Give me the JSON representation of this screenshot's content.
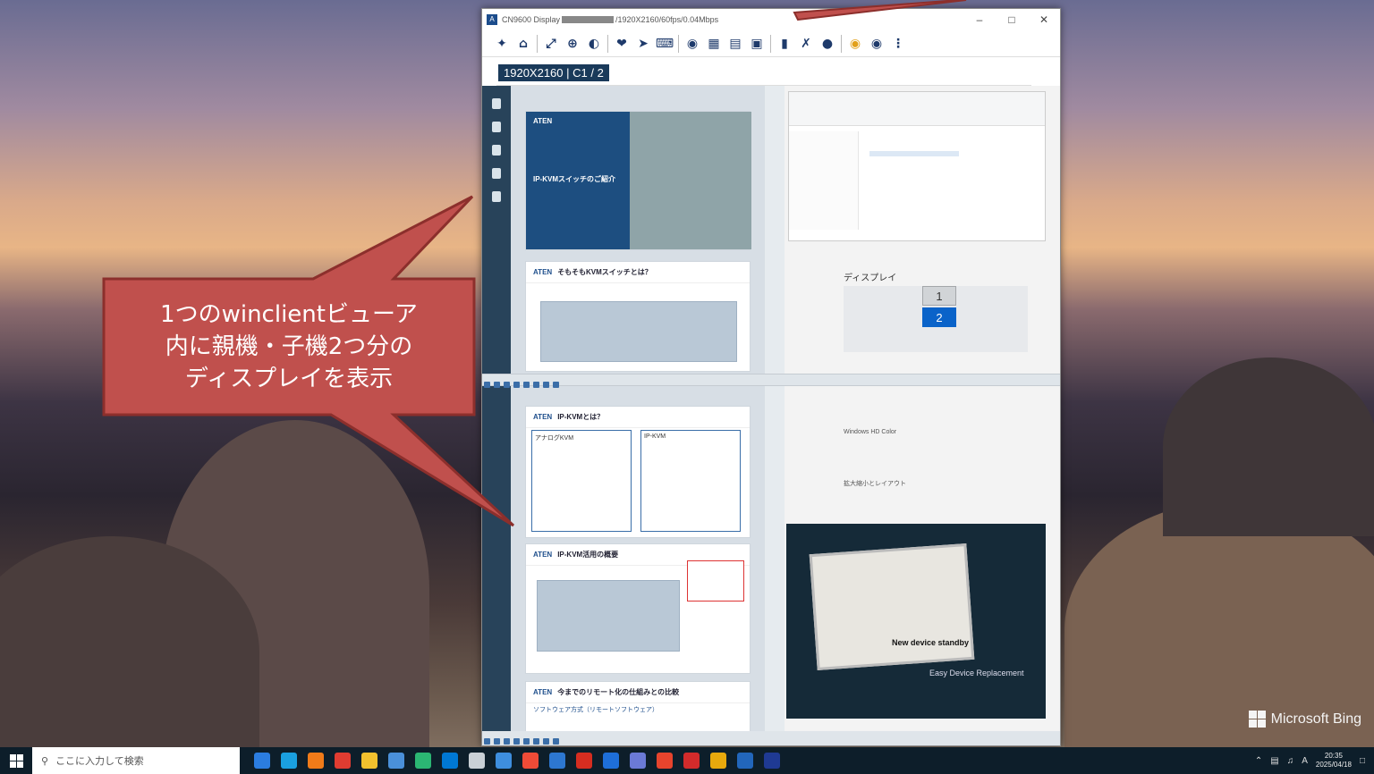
{
  "window": {
    "title_prefix": "CN9600 Display",
    "title_suffix": "/1920X2160/60fps/0.04Mbps",
    "resolution_label": "1920X2160 | C1 / 2",
    "toolbar_icons": [
      "pin-icon",
      "home-icon",
      "fullscreen-icon",
      "zoom-icon",
      "contrast-icon",
      "macro-icon",
      "pointer-icon",
      "keyboard-icon",
      "camera-icon",
      "video-icon",
      "panel-icon",
      "list-icon",
      "usb-icon",
      "tools-icon",
      "chat-icon",
      "lock-icon",
      "unlock-icon",
      "more-icon"
    ]
  },
  "remote": {
    "slides": [
      {
        "brand": "ATEN",
        "title": "IP-KVMスイッチのご紹介"
      },
      {
        "brand": "ATEN",
        "title": "そもそもKVMスイッチとは？"
      },
      {
        "brand": "ATEN",
        "title": "IP-KVMとは？"
      },
      {
        "brand": "ATEN",
        "title": "IP-KVM活用の概要"
      },
      {
        "brand": "ATEN",
        "title": "今までのリモート化の仕組みとの比較"
      }
    ],
    "slide2_sub": "ソフトウェア方式（リモートソフトウェア）",
    "kvm_labels": {
      "analog": "アナログKVM",
      "ip": "IP-KVM"
    },
    "display_title": "ディスプレイ",
    "monitors": [
      "1",
      "2"
    ],
    "settings": {
      "hdr": "Windows HD Color",
      "scale": "拡大縮小とレイアウト"
    },
    "video_caption": "Easy Device Replacement",
    "video_overlay": "New device standby"
  },
  "callout": {
    "lines": [
      "1つのwinclientビューア",
      "内に親機・子機2つ分の",
      "ディスプレイを表示"
    ],
    "color": "#c0504d"
  },
  "desktop": {
    "watermark": "Microsoft Bing"
  },
  "taskbar": {
    "search_placeholder": "ここに入力して検索",
    "apps": [
      "#2b7de0",
      "#1aa0e0",
      "#f07b19",
      "#e03c31",
      "#f2c12e",
      "#4a90d9",
      "#2bb673",
      "#0078d4",
      "#c9d0d6",
      "#3e8ede",
      "#ef4b37",
      "#2d77d0",
      "#d62d20",
      "#1e6fd9",
      "#6b7ad6",
      "#e7442d",
      "#d22b2b",
      "#e8a90d",
      "#2266bb",
      "#1f3a93"
    ],
    "clock_time": "20:35",
    "clock_date": "2025/04/18",
    "ime": "A"
  }
}
